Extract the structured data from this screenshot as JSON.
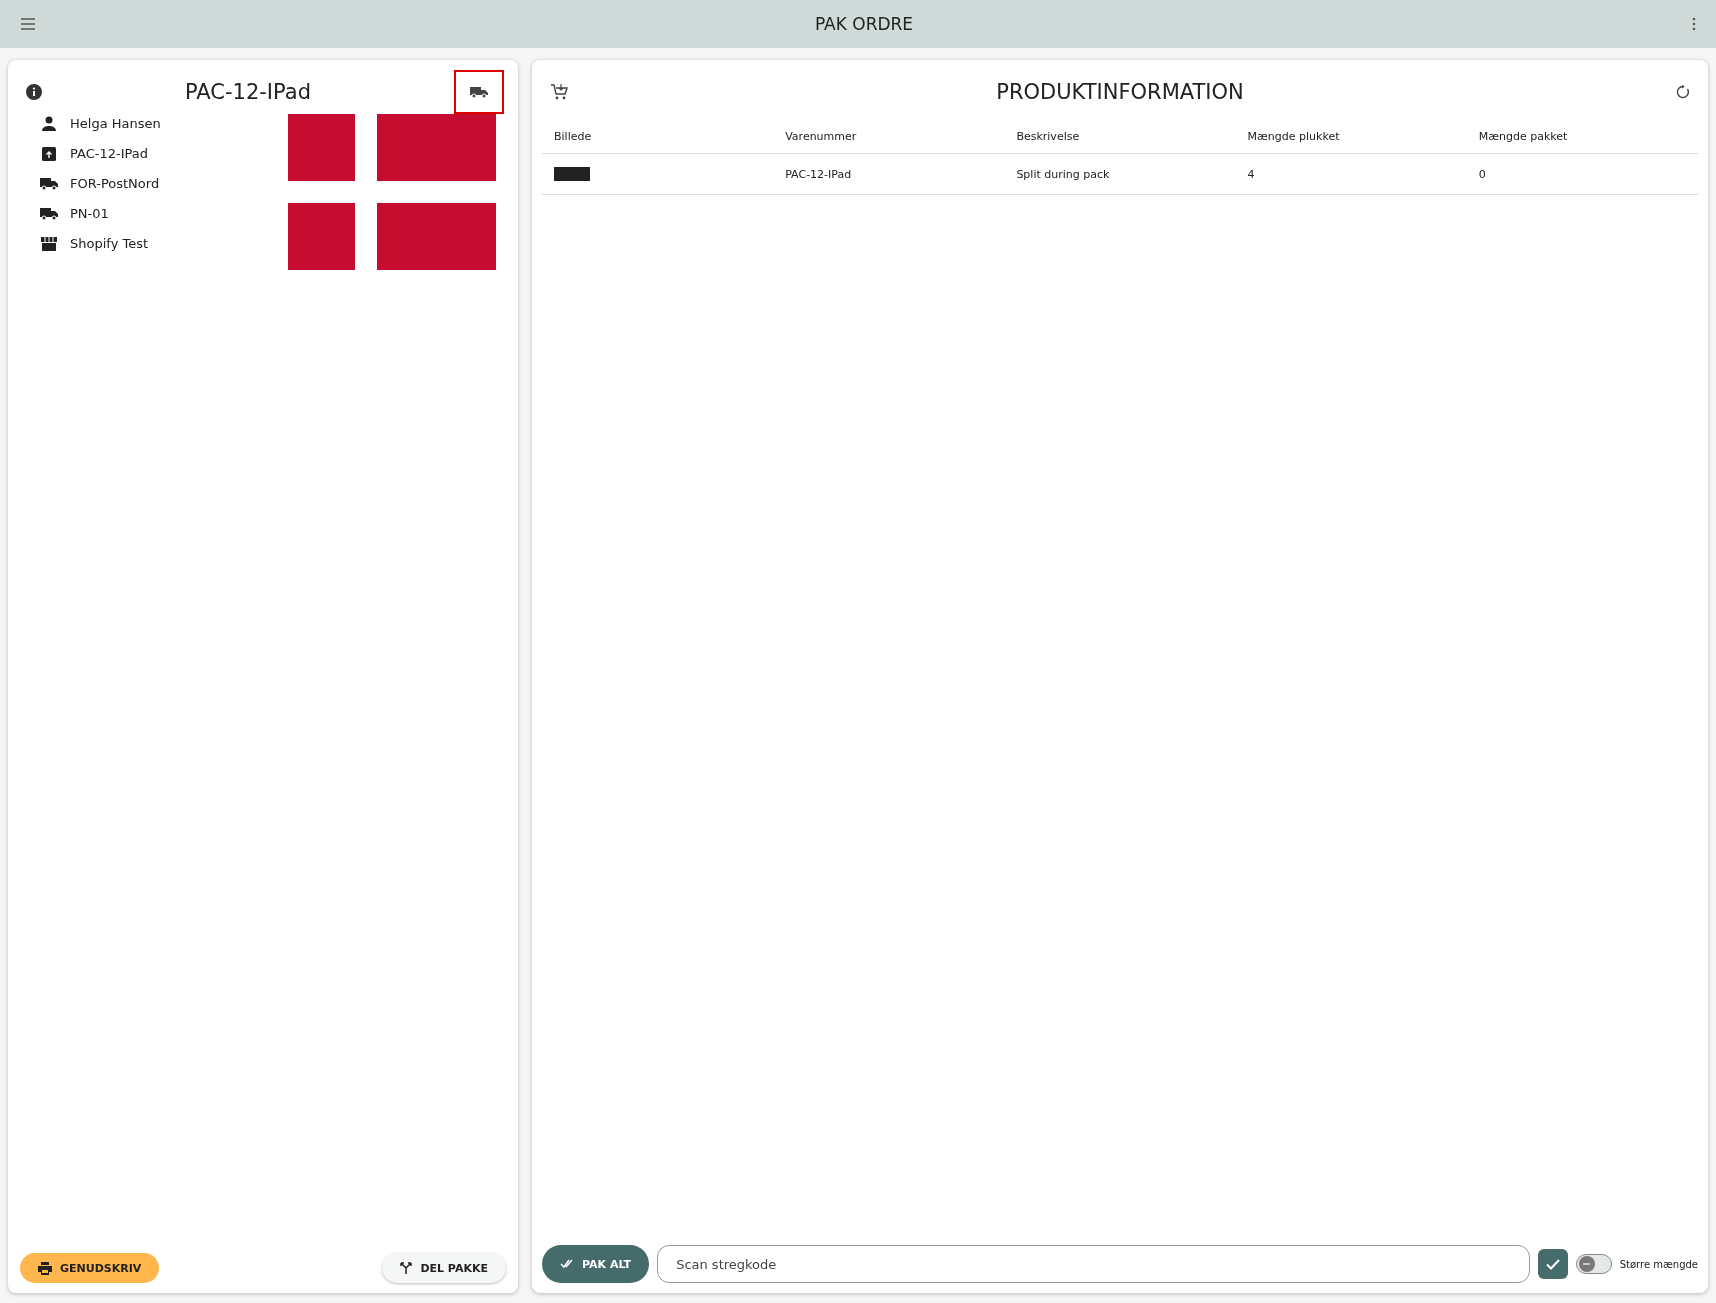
{
  "app_bar": {
    "title": "PAK ORDRE"
  },
  "order_panel": {
    "title": "PAC-12-IPad",
    "details": [
      {
        "kind": "person",
        "text": "Helga Hansen"
      },
      {
        "kind": "package",
        "text": "PAC-12-IPad"
      },
      {
        "kind": "truck",
        "text": "FOR-PostNord"
      },
      {
        "kind": "truck",
        "text": "PN-01"
      },
      {
        "kind": "store",
        "text": "Shopify Test"
      }
    ],
    "reprint_button": "GENUDSKRIV",
    "split_button": "DEL PAKKE"
  },
  "product_panel": {
    "title": "PRODUKTINFORMATION",
    "table": {
      "columns": [
        "Billede",
        "Varenummer",
        "Beskrivelse",
        "Mængde plukket",
        "Mængde pakket"
      ],
      "rows": [
        {
          "item_number": "PAC-12-IPad",
          "description": "Split during pack",
          "picked": "4",
          "packed": "0"
        }
      ]
    },
    "pack_all_button": "PAK ALT",
    "scan_field": {
      "placeholder": "Scan stregkode"
    },
    "larger_quantity": {
      "label": "Større mængde",
      "on": false
    }
  }
}
